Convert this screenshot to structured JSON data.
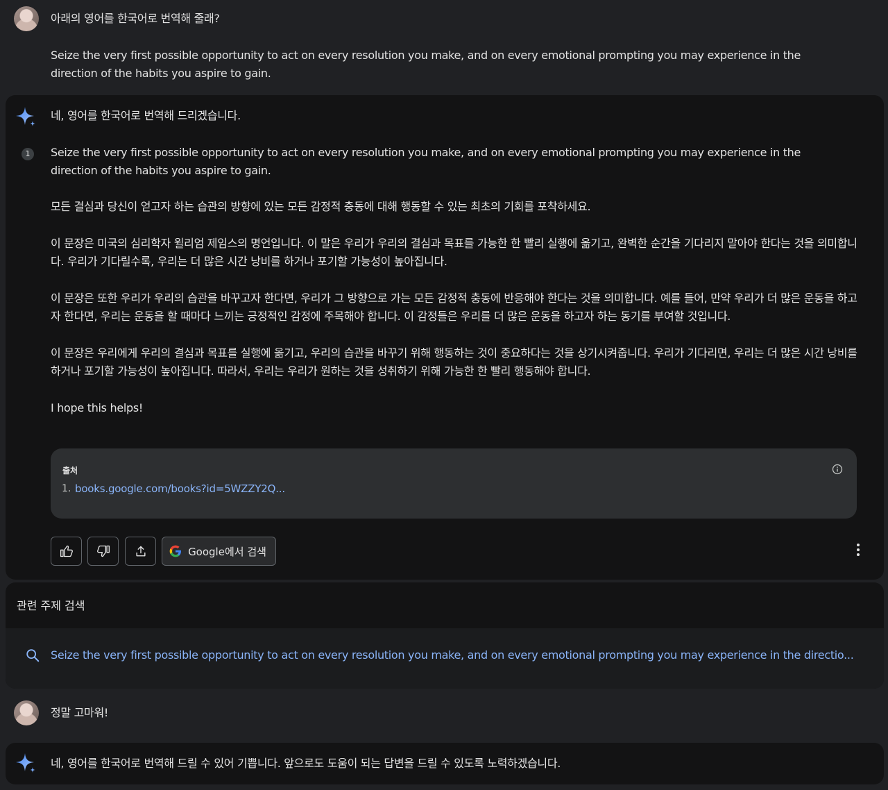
{
  "conversation": {
    "user_message_1": {
      "line1": "아래의 영어를 한국어로 번역해 줄래?",
      "line2": "Seize the very first possible opportunity to act on every resolution you make, and on every emotional prompting you may experience in the direction of the habits you aspire to gain."
    },
    "response_1": {
      "intro": "네, 영어를 한국어로 번역해 드리겠습니다.",
      "citation_marker": "1",
      "quote": "Seize the very first possible opportunity to act on every resolution you make, and on every emotional prompting you may experience in the direction of the habits you aspire to gain.",
      "translation": "모든 결심과 당신이 얻고자 하는 습관의 방향에 있는 모든 감정적 충동에 대해 행동할 수 있는 최초의 기회를 포착하세요.",
      "para1": "이 문장은 미국의 심리학자 윌리엄 제임스의 명언입니다. 이 말은 우리가 우리의 결심과 목표를 가능한 한 빨리 실행에 옮기고, 완벽한 순간을 기다리지 말아야 한다는 것을 의미합니다. 우리가 기다릴수록, 우리는 더 많은 시간 낭비를 하거나 포기할 가능성이 높아집니다.",
      "para2": "이 문장은 또한 우리가 우리의 습관을 바꾸고자 한다면, 우리가 그 방향으로 가는 모든 감정적 충동에 반응해야 한다는 것을 의미합니다. 예를 들어, 만약 우리가 더 많은 운동을 하고자 한다면, 우리는 운동을 할 때마다 느끼는 긍정적인 감정에 주목해야 합니다. 이 감정들은 우리를 더 많은 운동을 하고자 하는 동기를 부여할 것입니다.",
      "para3": "이 문장은 우리에게 우리의 결심과 목표를 실행에 옮기고, 우리의 습관을 바꾸기 위해 행동하는 것이 중요하다는 것을 상기시켜줍니다. 우리가 기다리면, 우리는 더 많은 시간 낭비를 하거나 포기할 가능성이 높아집니다. 따라서, 우리는 우리가 원하는 것을 성취하기 위해 가능한 한 빨리 행동해야 합니다.",
      "closing": "I hope this helps!",
      "sources": {
        "title": "출처",
        "items": [
          {
            "num": "1.",
            "link": "books.google.com/books?id=5WZZY2Q..."
          }
        ]
      },
      "actions": {
        "google_search_label": "Google에서 검색"
      }
    },
    "related": {
      "title": "관련 주제 검색",
      "query": "Seize the very first possible opportunity to act on every resolution you make, and on every emotional prompting you may experience in the directio..."
    },
    "user_message_2": {
      "text": "정말 고마워!"
    },
    "response_2": {
      "text": "네, 영어를 한국어로 번역해 드릴 수 있어 기쁩니다. 앞으로도 도움이 되는 답변을 드릴 수 있도록 노력하겠습니다."
    }
  },
  "colors": {
    "background": "#202124",
    "card": "#131314",
    "link": "#8ab4f8",
    "sparkle_start": "#4285f4",
    "sparkle_end": "#a8c7fa"
  },
  "icons": [
    "sparkle-icon",
    "thumbs-up-icon",
    "thumbs-down-icon",
    "share-icon",
    "google-g-icon",
    "more-vert-icon",
    "info-icon",
    "search-icon"
  ]
}
